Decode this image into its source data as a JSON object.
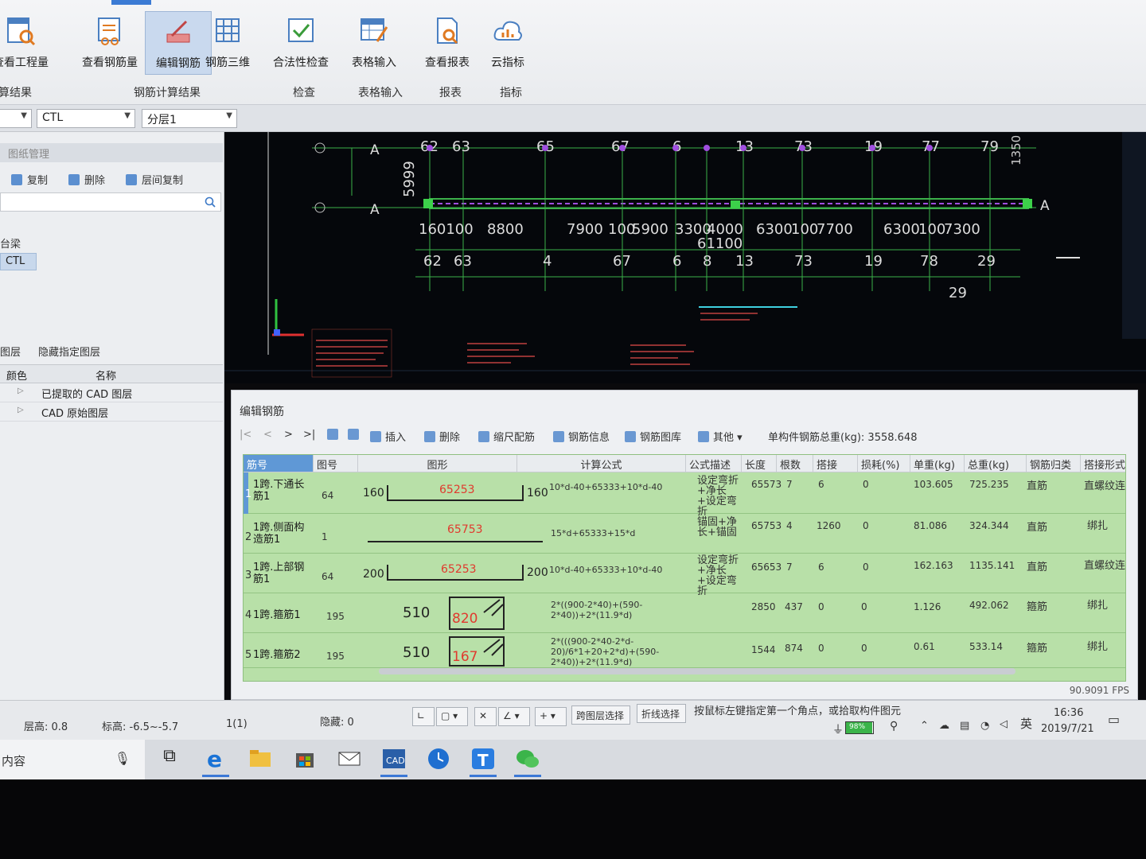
{
  "ribbon": {
    "buttons": [
      {
        "label": "查看工程量",
        "icon": "table-search-icon"
      },
      {
        "label": "查看钢筋量",
        "icon": "rebar-quantity-icon"
      },
      {
        "label": "编辑钢筋",
        "icon": "edit-rebar-icon",
        "active": true
      },
      {
        "label": "钢筋三维",
        "icon": "rebar-3d-icon"
      },
      {
        "label": "合法性检查",
        "icon": "check-icon"
      },
      {
        "label": "表格输入",
        "icon": "table-input-icon"
      },
      {
        "label": "查看报表",
        "icon": "report-icon"
      },
      {
        "label": "云指标",
        "icon": "cloud-index-icon"
      }
    ],
    "groups": [
      "算结果",
      "钢筋计算结果",
      "检查",
      "表格输入",
      "报表",
      "指标"
    ]
  },
  "selectors": {
    "component": "CTL",
    "floor": "分层1"
  },
  "left_panel": {
    "drawing_manager": "图纸管理",
    "tools": [
      "复制",
      "删除",
      "层间复制"
    ],
    "category": "台梁",
    "selected_item": "CTL",
    "layer_tabs": [
      "图层",
      "隐藏指定图层"
    ],
    "layer_columns": [
      "颜色",
      "名称"
    ],
    "layers": [
      "已提取的 CAD 图层",
      "CAD 原始图层"
    ]
  },
  "cad": {
    "axis_top": [
      "62",
      "63",
      "65",
      "67",
      "6",
      "13",
      "73",
      "19",
      "77",
      "79"
    ],
    "axis_bottom": [
      "62",
      "63",
      "4",
      "67",
      "6",
      "8",
      "13",
      "73",
      "19",
      "78",
      "29"
    ],
    "dims": [
      "160100",
      "8800",
      "7900",
      "100",
      "5900",
      "3300",
      "4000",
      "6300",
      "100",
      "7700",
      "6300",
      "100",
      "7300"
    ],
    "sub_dim": "61100",
    "left_dim": "5999",
    "grid_labels": [
      "A",
      "A",
      "A"
    ],
    "extra_label": "29",
    "right_dim": "1350"
  },
  "edit_panel": {
    "title": "编辑钢筋",
    "toolbar": [
      "插入",
      "删除",
      "缩尺配筋",
      "钢筋信息",
      "钢筋图库",
      "其他"
    ],
    "nav": [
      "|<",
      "<",
      ">",
      ">|"
    ],
    "total_label": "单构件钢筋总重(kg): 3558.648",
    "columns": [
      "筋号",
      "图号",
      "图形",
      "计算公式",
      "公式描述",
      "长度",
      "根数",
      "搭接",
      "损耗(%)",
      "单重(kg)",
      "总重(kg)",
      "钢筋归类",
      "搭接形式"
    ],
    "rows": [
      {
        "no": "1",
        "name": "1跨.下通长筋1",
        "fig": "64",
        "left": "160",
        "mid": "65253",
        "right": "160",
        "formula": "10*d-40+65333+10*d-40",
        "desc": "设定弯折+净长+设定弯折",
        "length": "65573",
        "count": "7",
        "lap": "6",
        "loss": "0",
        "unit_w": "103.605",
        "total_w": "725.235",
        "type": "直筋",
        "lap_type": "直螺纹连"
      },
      {
        "no": "2",
        "name": "1跨.侧面构造筋1",
        "fig": "1",
        "left": "",
        "mid": "65753",
        "right": "",
        "formula": "15*d+65333+15*d",
        "desc": "锚固+净长+锚固",
        "length": "65753",
        "count": "4",
        "lap": "1260",
        "loss": "0",
        "unit_w": "81.086",
        "total_w": "324.344",
        "type": "直筋",
        "lap_type": "绑扎"
      },
      {
        "no": "3",
        "name": "1跨.上部钢筋1",
        "fig": "64",
        "left": "200",
        "mid": "65253",
        "right": "200",
        "formula": "10*d-40+65333+10*d-40",
        "desc": "设定弯折+净长+设定弯折",
        "length": "65653",
        "count": "7",
        "lap": "6",
        "loss": "0",
        "unit_w": "162.163",
        "total_w": "1135.141",
        "type": "直筋",
        "lap_type": "直螺纹连"
      },
      {
        "no": "4",
        "name": "1跨.箍筋1",
        "fig": "195",
        "left": "510",
        "mid": "820",
        "right": "",
        "formula": "2*((900-2*40)+(590-2*40))+2*(11.9*d)",
        "desc": "",
        "length": "2850",
        "count": "437",
        "lap": "0",
        "loss": "0",
        "unit_w": "1.126",
        "total_w": "492.062",
        "type": "箍筋",
        "lap_type": "绑扎"
      },
      {
        "no": "5",
        "name": "1跨.箍筋2",
        "fig": "195",
        "left": "510",
        "mid": "167",
        "right": "",
        "formula": "2*(((900-2*40-2*d-20)/6*1+20+2*d)+(590-2*40))+2*(11.9*d)",
        "desc": "",
        "length": "1544",
        "count": "874",
        "lap": "0",
        "loss": "0",
        "unit_w": "0.61",
        "total_w": "533.14",
        "type": "箍筋",
        "lap_type": "绑扎"
      }
    ],
    "fps": "90.9091 FPS"
  },
  "status": {
    "floor_height": "层高: 0.8",
    "elevation": "标高: -6.5~-5.7",
    "page": "1(1)",
    "hidden": "隐藏: 0",
    "btn_cross": "跨图层选择",
    "btn_poly": "折线选择",
    "hint": "按鼠标左键指定第一个角点，或拾取构件图元"
  },
  "taskbar": {
    "search": "内容",
    "battery": "98%",
    "ime": "英",
    "time": "16:36",
    "date": "2019/7/21"
  }
}
